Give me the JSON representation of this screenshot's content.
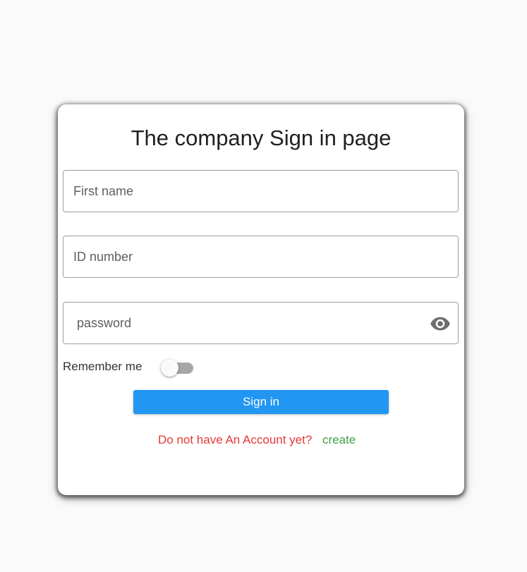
{
  "page": {
    "title": "The company Sign in page"
  },
  "form": {
    "first_name": {
      "placeholder": "First name",
      "value": ""
    },
    "id_number": {
      "placeholder": "ID number",
      "value": ""
    },
    "password": {
      "placeholder": "password",
      "value": ""
    },
    "password_toggle_icon": "eye-icon",
    "remember_label": "Remember me",
    "remember_on": false,
    "sign_in_label": "Sign in"
  },
  "footer": {
    "prompt": "Do not have An Account yet?",
    "create_label": "create"
  },
  "colors": {
    "background": "#fafafa",
    "primary": "#2196f3",
    "prompt": "#e53935",
    "link": "#43a047",
    "switch_track_off": "#a6a6a6"
  }
}
